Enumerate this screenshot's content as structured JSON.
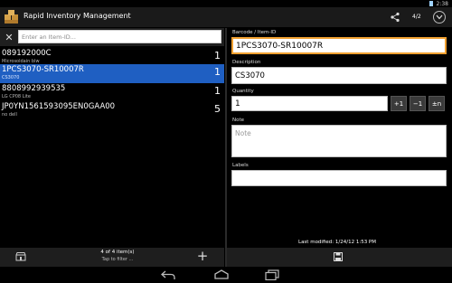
{
  "status_bar": {
    "time": "2:38"
  },
  "action_bar": {
    "title": "Rapid Inventory Management",
    "page_counter": "4/2"
  },
  "search": {
    "placeholder": "Enter an Item-ID..."
  },
  "items": [
    {
      "code": "089192000C",
      "description": "Microsoldain blw",
      "quantity": "1"
    },
    {
      "code": "1PCS3070-SR10007R",
      "description": "CS3070",
      "quantity": "1",
      "selected": true
    },
    {
      "code": "8808992939535",
      "description": "LG CP08 Lite",
      "quantity": "1"
    },
    {
      "code": "JP0YN1561593095EN0GAA00",
      "description": "no dell",
      "quantity": "5"
    }
  ],
  "left_footer": {
    "count": "4 of 4 item(s)",
    "filter_hint": "Tap to filter ..."
  },
  "form": {
    "barcode_label": "Barcode / Item-ID",
    "barcode_value": "1PCS3070-SR10007R",
    "description_label": "Description",
    "description_value": "CS3070",
    "quantity_label": "Quantity",
    "quantity_value": "1",
    "plus_one": "+1",
    "minus_one": "−1",
    "plus_minus_n": "±n",
    "note_label": "Note",
    "note_placeholder": "Note",
    "labels_label": "Labels",
    "labels_value": "",
    "last_modified": "Last modified: 1/24/12 1:53 PM"
  },
  "colors": {
    "accent": "#1f5fc2",
    "focus": "#f0a030"
  },
  "icons": [
    "app-icon",
    "share-icon",
    "overflow-icon",
    "close-icon",
    "store-icon",
    "add-icon",
    "save-icon",
    "back-icon",
    "home-icon",
    "recents-icon"
  ]
}
